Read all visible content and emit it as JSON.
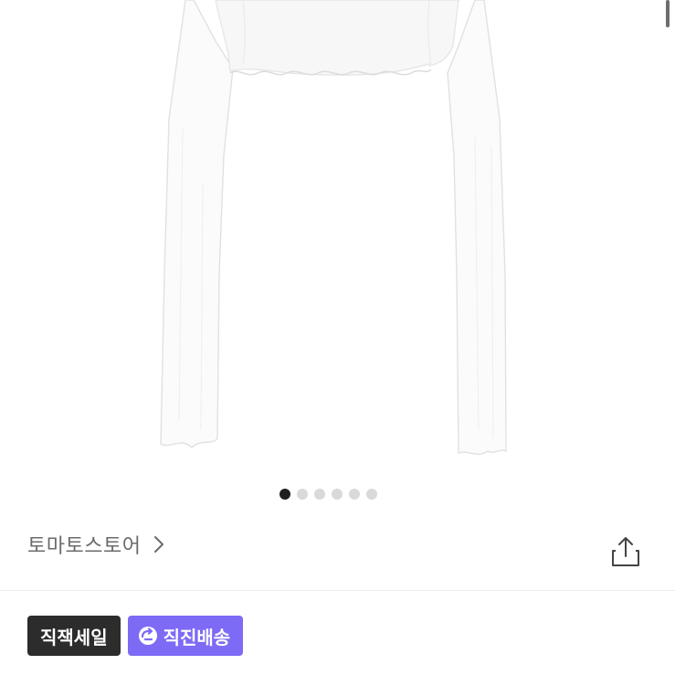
{
  "product": {
    "image_count": 6,
    "active_image_index": 0
  },
  "store": {
    "name": "토마토스토어"
  },
  "badges": {
    "direct_sale": "직잭세일",
    "direct_delivery": "직진배송"
  },
  "colors": {
    "active_dot": "#1f1f1f",
    "inactive_dot": "#d9d9d9",
    "direct_sale_bg": "#2c2c2c",
    "direct_delivery_bg": "#7d6af5",
    "store_text": "#6b6b6b"
  },
  "icons": {
    "store_chevron": "chevron-right-icon",
    "share": "share-icon",
    "delivery": "delivery-arrow-icon"
  }
}
